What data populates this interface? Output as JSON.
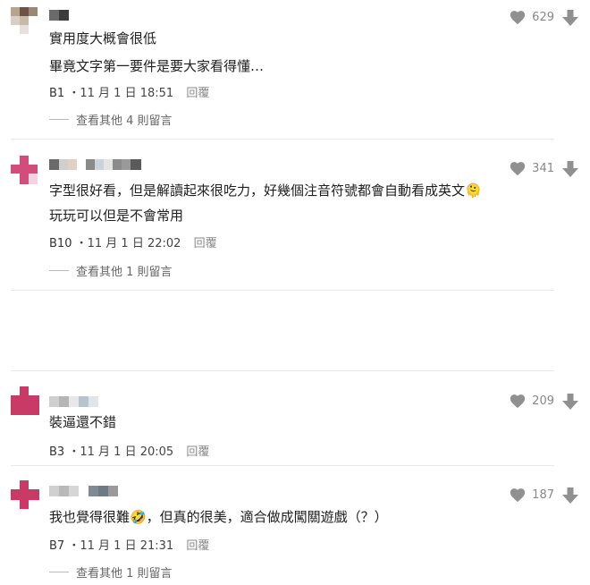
{
  "comments": [
    {
      "lines": [
        "實用度大概會很低",
        "畢竟文字第一要件是要大家看得懂…"
      ],
      "floor": "B1",
      "date": "11 月 1 日 18:51",
      "reply_label": "回覆",
      "likes": "629",
      "more_replies": "查看其他 4 則留言"
    },
    {
      "lines": [
        "字型很好看，但是解讀起來很吃力，好幾個注音符號都會自動看成英文🫠",
        "玩玩可以但是不會常用"
      ],
      "floor": "B10",
      "date": "11 月 1 日 22:02",
      "reply_label": "回覆",
      "likes": "341",
      "more_replies": "查看其他 1 則留言"
    },
    {
      "lines": [
        "裝逼還不錯"
      ],
      "floor": "B3",
      "date": "11 月 1 日 20:05",
      "reply_label": "回覆",
      "likes": "209",
      "more_replies": ""
    },
    {
      "lines": [
        "我也覺得很難🤣，但真的很美，適合做成闖關遊戲（？）"
      ],
      "floor": "B7",
      "date": "11 月 1 日 21:31",
      "reply_label": "回覆",
      "likes": "187",
      "more_replies": "查看其他 1 則留言"
    }
  ],
  "icons": {
    "like": "heart-icon",
    "dislike": "down-arrow-icon"
  },
  "colors": {
    "icon_gray": "#909090",
    "text": "#202020",
    "muted": "#888888"
  }
}
